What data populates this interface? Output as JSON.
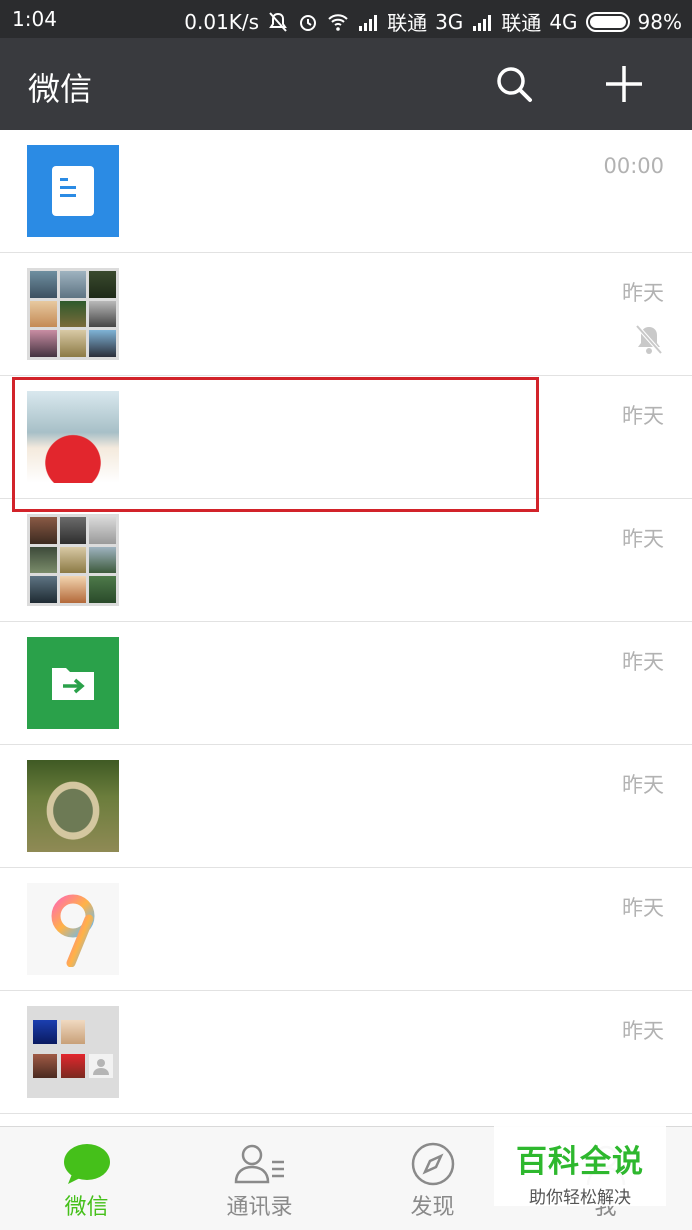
{
  "status_bar": {
    "time": "1:04",
    "speed": "0.01K/s",
    "carrier1": "联通",
    "net1": "3G",
    "carrier2": "联通",
    "net2": "4G",
    "battery": "98%"
  },
  "header": {
    "title": "微信"
  },
  "chats": [
    {
      "time": "00:00",
      "avatar": "document-icon"
    },
    {
      "time": "昨天",
      "avatar": "group-collage",
      "muted": true
    },
    {
      "time": "昨天",
      "avatar": "red-umbrella-photo"
    },
    {
      "time": "昨天",
      "avatar": "group-collage"
    },
    {
      "time": "昨天",
      "avatar": "file-transfer-icon"
    },
    {
      "time": "昨天",
      "avatar": "pond-photo"
    },
    {
      "time": "昨天",
      "avatar": "miui-nine-logo"
    },
    {
      "time": "昨天",
      "avatar": "group-collage"
    }
  ],
  "tabs": [
    {
      "label": "微信",
      "icon": "chat-bubble-icon",
      "active": true
    },
    {
      "label": "通讯录",
      "icon": "contacts-icon",
      "active": false
    },
    {
      "label": "发现",
      "icon": "compass-icon",
      "active": false
    },
    {
      "label": "我",
      "icon": "me-icon",
      "active": false
    }
  ],
  "watermark": {
    "title": "百科全说",
    "subtitle": "助你轻松解决"
  },
  "colors": {
    "accent_green": "#45c01a",
    "header_bg": "#393a3e",
    "highlight_red": "#d2232a"
  }
}
